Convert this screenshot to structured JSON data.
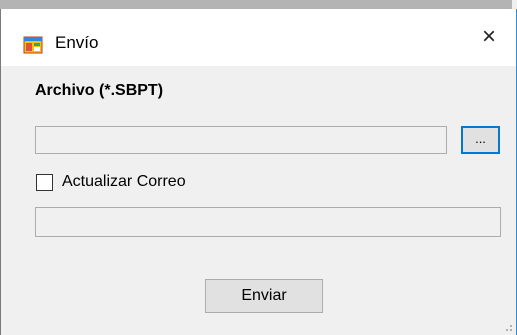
{
  "window": {
    "title": "Envío",
    "close_glyph": "×",
    "icon": "app-window-icon"
  },
  "form": {
    "file_label": "Archivo (*.SBPT)",
    "file_path_value": "",
    "browse_label": "...",
    "update_mail_label": "Actualizar Correo",
    "update_mail_checked": false,
    "mail_value": "",
    "send_label": "Enviar"
  },
  "colors": {
    "accent": "#0078d7",
    "client_bg": "#f0f0f0"
  }
}
